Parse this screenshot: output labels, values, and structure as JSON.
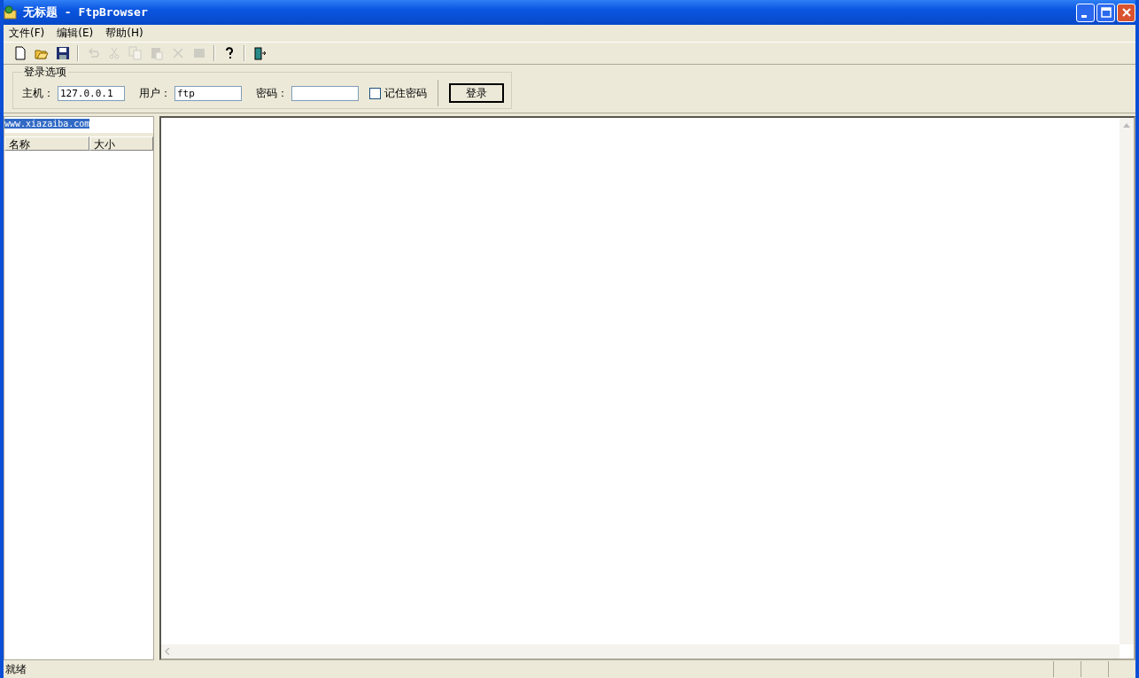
{
  "window": {
    "title": "无标题 - FtpBrowser"
  },
  "menu": [
    "文件(F)",
    "编辑(E)",
    "帮助(H)"
  ],
  "toolbar": [
    {
      "kind": "new",
      "disabled": false
    },
    {
      "kind": "open",
      "disabled": false
    },
    {
      "kind": "save",
      "disabled": false
    },
    {
      "kind": "sep"
    },
    {
      "kind": "undo",
      "disabled": true
    },
    {
      "kind": "cut",
      "disabled": true
    },
    {
      "kind": "copy",
      "disabled": true
    },
    {
      "kind": "paste",
      "disabled": true
    },
    {
      "kind": "delete",
      "disabled": true
    },
    {
      "kind": "stop",
      "disabled": true
    },
    {
      "kind": "sep"
    },
    {
      "kind": "help",
      "disabled": false
    },
    {
      "kind": "sep"
    },
    {
      "kind": "exit",
      "disabled": false
    }
  ],
  "login": {
    "legend": "登录选项",
    "host_label": "主机：",
    "host": "127.0.0.1",
    "user_label": "用户：",
    "user": "ftp",
    "password_label": "密码：",
    "remember": {
      "label": "记住密码",
      "checked": false
    },
    "button": "登录"
  },
  "left_panel": {
    "address": "www.xiazaiba.com",
    "address_selected": true,
    "columns": [
      "名称",
      "大小"
    ]
  },
  "status_bar": {
    "text": "就绪"
  }
}
